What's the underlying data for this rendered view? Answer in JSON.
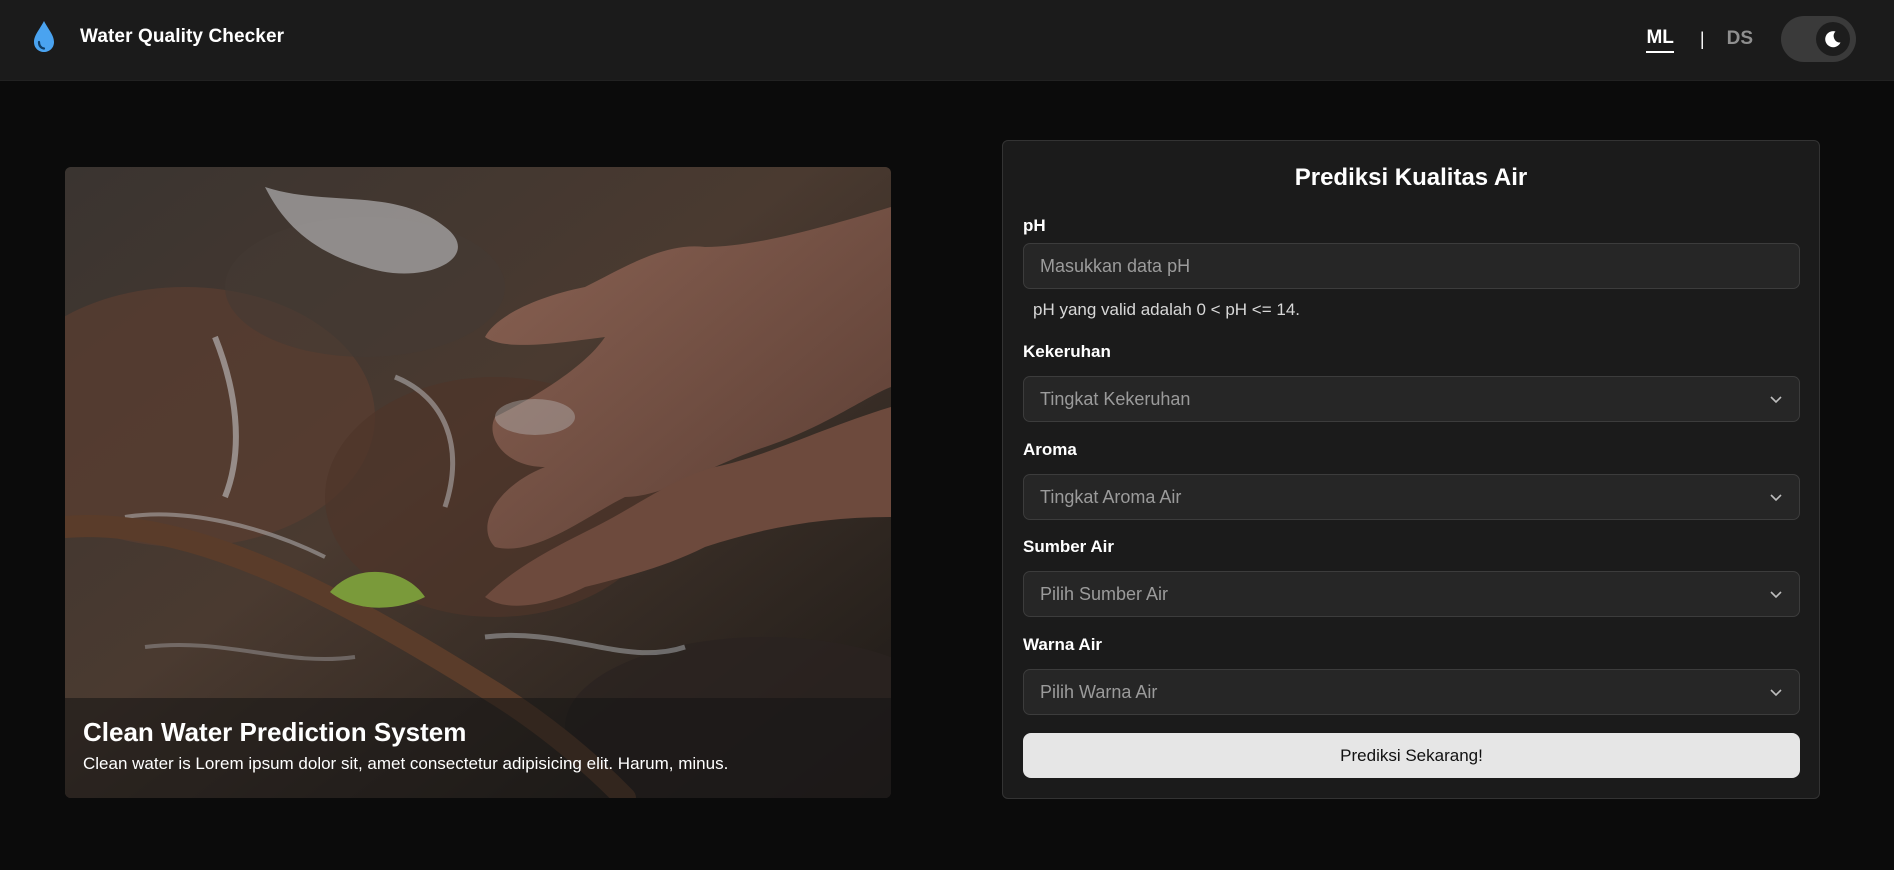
{
  "navbar": {
    "brand_icon": "water-drop-icon",
    "brand_title": "Water Quality Checker",
    "links": [
      {
        "label": "ML",
        "active": true
      },
      {
        "label": "DS",
        "active": false
      }
    ],
    "separator": "|",
    "theme_toggle_icon": "moon-icon"
  },
  "hero": {
    "title": "Clean Water Prediction System",
    "description": "Clean water is Lorem ipsum dolor sit, amet consectetur adipisicing elit. Harum, minus."
  },
  "form": {
    "title": "Prediksi Kualitas Air",
    "ph": {
      "label": "pH",
      "placeholder": "Masukkan data pH",
      "hint": "pH yang valid adalah 0 < pH <= 14."
    },
    "kekeruhan": {
      "label": "Kekeruhan",
      "selected": "Tingkat Kekeruhan"
    },
    "aroma": {
      "label": "Aroma",
      "selected": "Tingkat Aroma Air"
    },
    "sumber": {
      "label": "Sumber Air",
      "selected": "Pilih Sumber Air"
    },
    "warna": {
      "label": "Warna Air",
      "selected": "Pilih Warna Air"
    },
    "submit_label": "Prediksi Sekarang!"
  },
  "colors": {
    "background": "#0b0b0b",
    "navbar": "#1b1b1b",
    "card": "#1b1b1b",
    "input": "#262626",
    "accent_drop": "#4aa3f0",
    "button": "#e6e6e6"
  }
}
